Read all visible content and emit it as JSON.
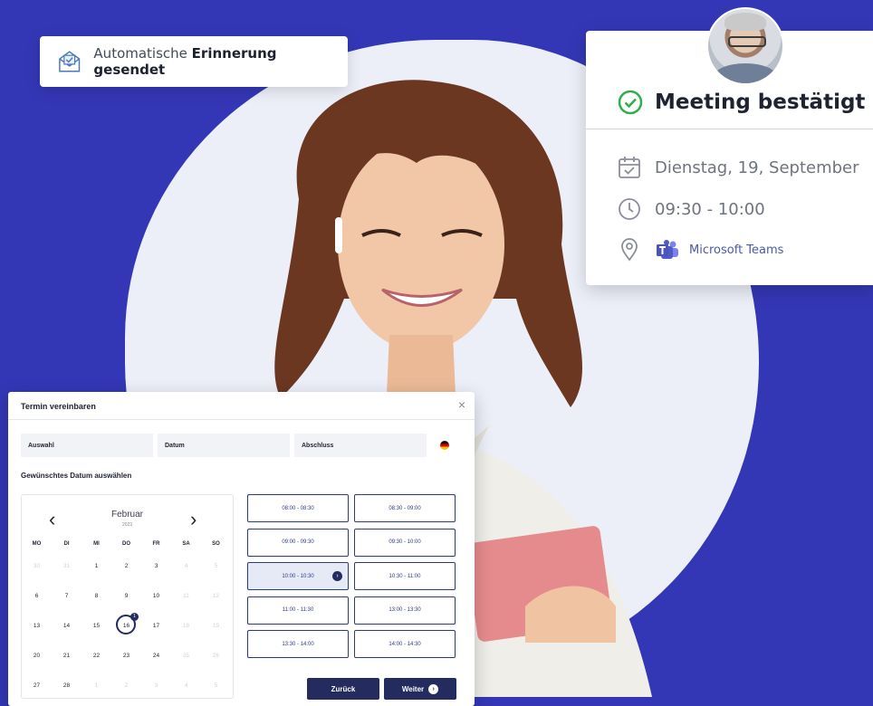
{
  "colors": {
    "background": "#3337b5",
    "navy": "#232b5f",
    "success": "#2fae4a",
    "teams": "#5059c9"
  },
  "reminder": {
    "prefix": "Automatische ",
    "bold": "Erinnerung gesendet",
    "icon": "envelope-check-icon"
  },
  "meeting": {
    "title": "Meeting bestätigt",
    "date": "Dienstag, 19, September",
    "time": "09:30 - 10:00",
    "location": "Microsoft Teams"
  },
  "widget": {
    "title": "Termin vereinbaren",
    "close": "×",
    "steps": [
      "Auswahl",
      "Datum",
      "Abschluss"
    ],
    "subtitle": "Gewünschtes Datum auswählen",
    "calendar": {
      "month": "Februar",
      "year": "2023",
      "prev": "‹",
      "next": "›",
      "weekdays": [
        "MO",
        "DI",
        "MI",
        "DO",
        "FR",
        "SA",
        "SO"
      ],
      "weeks": [
        [
          "30",
          "31",
          "1",
          "2",
          "3",
          "4",
          "5"
        ],
        [
          "6",
          "7",
          "8",
          "9",
          "10",
          "11",
          "12"
        ],
        [
          "13",
          "14",
          "15",
          "16",
          "17",
          "18",
          "19"
        ],
        [
          "20",
          "21",
          "22",
          "23",
          "24",
          "25",
          "26"
        ],
        [
          "27",
          "28",
          "1",
          "2",
          "3",
          "4",
          "5"
        ]
      ],
      "selected": "16",
      "selected_badge": "1"
    },
    "slots": [
      [
        "08:00 - 08:30",
        "08:30 - 09:00"
      ],
      [
        "09:00 - 09:30",
        "09:30 - 10:00"
      ],
      [
        "10:00 - 10:30",
        "10:30 - 11:00"
      ],
      [
        "11:00 - 11:30",
        "13:00 - 13:30"
      ],
      [
        "13:30 - 14:00",
        "14:00 - 14:30"
      ]
    ],
    "active_slot": "10:00 - 10:30",
    "back": "Zurück",
    "next": "Weiter"
  }
}
